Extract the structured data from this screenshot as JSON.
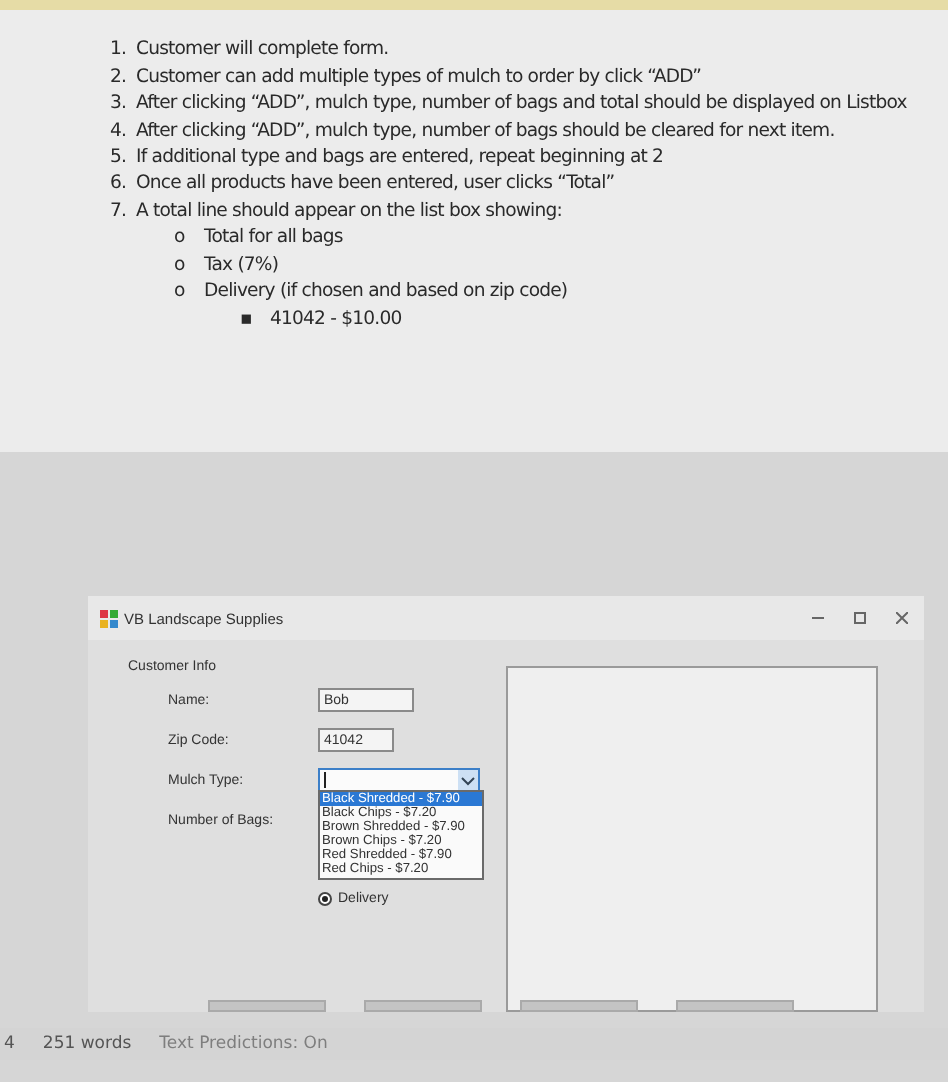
{
  "document": {
    "steps": [
      {
        "number": "1.",
        "text": "Customer will complete form."
      },
      {
        "number": "2.",
        "text": "Customer can add multiple types of mulch to order by click “ADD”"
      },
      {
        "number": "3.",
        "text": "After clicking “ADD”, mulch type, number of bags and total should be displayed on Listbox"
      },
      {
        "number": "4.",
        "text": "After clicking “ADD”, mulch type, number of bags should be cleared for next item."
      },
      {
        "number": "5.",
        "text": "If additional type and bags are entered, repeat beginning at 2"
      },
      {
        "number": "6.",
        "text": "Once all products have been entered, user clicks “Total”"
      },
      {
        "number": "7.",
        "text": "A total line should appear on the list box showing:",
        "children": [
          {
            "marker": "o",
            "text": "Total for all bags"
          },
          {
            "marker": "o",
            "text": "Tax (7%)"
          },
          {
            "marker": "o",
            "text": "Delivery (if chosen and based on zip code)",
            "children": [
              {
                "marker": "▪",
                "text": "41042 - $10.00"
              }
            ]
          }
        ]
      }
    ]
  },
  "form": {
    "title": "VB Landscape Supplies",
    "group_label": "Customer Info",
    "fields": [
      {
        "kind": "text",
        "label": "Name:",
        "value": "Bob"
      },
      {
        "kind": "text",
        "label": "Zip Code:",
        "value": "41042"
      },
      {
        "kind": "combo",
        "label": "Mulch Type:",
        "expanded": true,
        "options": [
          {
            "label": "Black Shredded - $7.90",
            "selected": true
          },
          {
            "label": "Black Chips - $7.20",
            "selected": false
          },
          {
            "label": "Brown Shredded - $7.90",
            "selected": false
          },
          {
            "label": "Brown Chips - $7.20",
            "selected": false
          },
          {
            "label": "Red Shredded - $7.90",
            "selected": false
          },
          {
            "label": "Red Chips - $7.20",
            "selected": false
          }
        ]
      },
      {
        "kind": "label",
        "label": "Number of Bags:"
      }
    ],
    "delivery": {
      "label": "Delivery",
      "selected": true
    }
  },
  "status_bar": {
    "page": "4",
    "words": "251 words",
    "predictions": "Text Predictions: On"
  }
}
